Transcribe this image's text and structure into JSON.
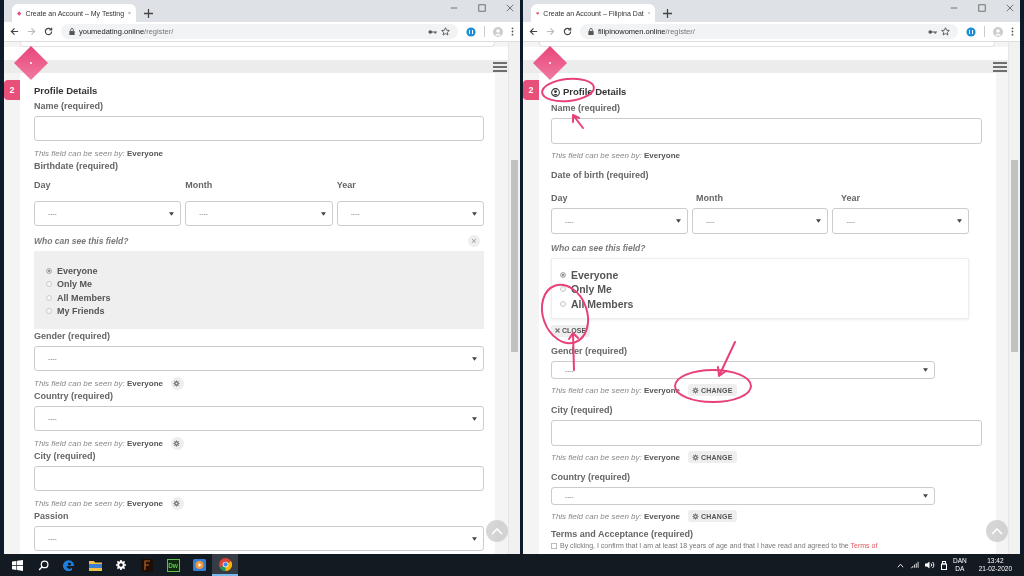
{
  "windows": [
    {
      "tab_title": "Create an Account – My Testing",
      "url_domain": "youmedating.online",
      "url_path": "/register/",
      "step": "2",
      "section": {
        "title": "Profile Details"
      },
      "fields": [
        {
          "kind": "text",
          "label": "Name (required)",
          "note": "This field can be seen by: **Everyone**"
        },
        {
          "kind": "date",
          "label": "Birthdate (required)",
          "parts": [
            {
              "label": "Day",
              "value": "----"
            },
            {
              "label": "Month",
              "value": "----"
            },
            {
              "label": "Year",
              "value": "----"
            }
          ]
        },
        {
          "kind": "visibility",
          "question": "Who can see this field?",
          "close_glyph": "×",
          "options": [
            {
              "label": "Everyone",
              "selected": true
            },
            {
              "label": "Only Me",
              "selected": false
            },
            {
              "label": "All Members",
              "selected": false
            },
            {
              "label": "My Friends",
              "selected": false
            }
          ]
        },
        {
          "kind": "select",
          "label": "Gender (required)",
          "value": "----",
          "note": "This field can be seen by: **Everyone**",
          "change_button": true
        },
        {
          "kind": "select",
          "label": "Country (required)",
          "value": "----",
          "note": "This field can be seen by: **Everyone**",
          "change_button": true
        },
        {
          "kind": "text",
          "label": "City (required)",
          "note": "This field can be seen by: **Everyone**",
          "change_button": true
        },
        {
          "kind": "select",
          "label": "Passion",
          "value": "----"
        }
      ]
    },
    {
      "annotated": true,
      "tab_title": "Create an Account – Filipina Dat",
      "url_domain": "filipinowomen.online",
      "url_path": "/register/",
      "step": "2",
      "section": {
        "title": "Profile Details",
        "icon": true
      },
      "fields": [
        {
          "kind": "text",
          "label": "Name (required)",
          "note": "This field can be seen by: **Everyone**"
        },
        {
          "kind": "date",
          "label": "Date of birth (required)",
          "parts": [
            {
              "label": "Day",
              "value": "----"
            },
            {
              "label": "Month",
              "value": "----"
            },
            {
              "label": "Year",
              "value": "----"
            }
          ]
        },
        {
          "kind": "visibility",
          "question": "Who can see this field?",
          "close_label": "CLOSE",
          "options": [
            {
              "label": "Everyone",
              "selected": true
            },
            {
              "label": "Only Me",
              "selected": false
            },
            {
              "label": "All Members",
              "selected": false
            }
          ]
        },
        {
          "kind": "select",
          "label": "Gender (required)",
          "value": "----",
          "note": "This field can be seen by: **Everyone**",
          "change_button": true,
          "change_label": "CHANGE"
        },
        {
          "kind": "text",
          "label": "City (required)",
          "note": "This field can be seen by: **Everyone**",
          "change_button": true,
          "change_label": "CHANGE"
        },
        {
          "kind": "select",
          "label": "Country (required)",
          "value": "----",
          "note": "This field can be seen by: **Everyone**",
          "change_button": true,
          "change_label": "CHANGE"
        },
        {
          "kind": "terms",
          "label": "Terms and Acceptance (required)",
          "checked": false,
          "text": "By clicking, I confirm that I am at least 18 years of age and that I have read and agreed to the",
          "link": "Terms of"
        }
      ]
    }
  ],
  "taskbar": {
    "apps": [
      {
        "kind": "start",
        "active": false
      },
      {
        "kind": "search",
        "active": false
      },
      {
        "kind": "edge",
        "active": false
      },
      {
        "kind": "folder",
        "active": false
      },
      {
        "kind": "settings",
        "active": false
      },
      {
        "kind": "dark-app",
        "active": false
      },
      {
        "kind": "dw",
        "label": "Dw",
        "active": false
      },
      {
        "kind": "player",
        "active": false
      },
      {
        "kind": "chrome",
        "active": true
      }
    ],
    "language": [
      "DAN",
      "DA"
    ],
    "time": "13:42",
    "date": "21-02-2020"
  }
}
